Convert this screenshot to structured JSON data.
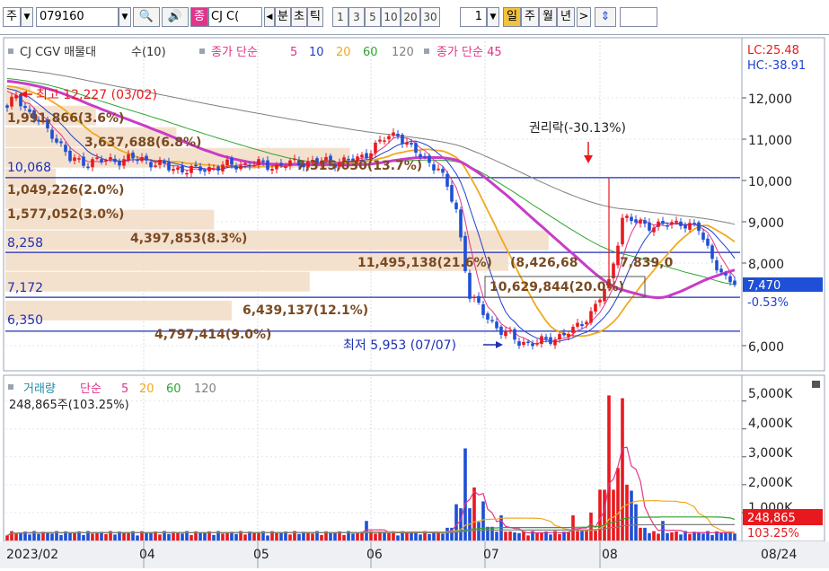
{
  "toolbar": {
    "market": "주",
    "code": "079160",
    "name_badge": "종",
    "name_short": "CJ  C(",
    "unit_label": "분",
    "unit_label2": "초",
    "unit_label3": "틱",
    "intervals": [
      "1",
      "3",
      "5",
      "10",
      "20",
      "30"
    ],
    "interval_count": "1",
    "periods": [
      "일",
      "주",
      "월",
      "년"
    ],
    "active_period": "일"
  },
  "colors": {
    "candle_up": "#e8191e",
    "candle_down": "#1f4fd6",
    "ma5": "#e0358a",
    "ma10": "#1f3fd0",
    "ma20": "#f0a920",
    "ma60": "#2ea52e",
    "ma120": "#808080",
    "ma45": "#c83cc8",
    "lc_hc": "#e8191e",
    "price_box": "#1f4fd6",
    "volume_box": "#e8191e",
    "hline": "#1e2fb5",
    "volume_profile": "#f2dcc4"
  },
  "price_panel": {
    "legend": {
      "name": "CJ CGV 매물대",
      "name_suffix": "수(10)",
      "ma_prefix": "종가 단순",
      "ma_periods": [
        "5",
        "10",
        "20",
        "60",
        "120"
      ],
      "ma45_label": "종가 단순 45"
    },
    "lc": "LC:25.48",
    "hc": "HC:-38.91",
    "axis_ticks": [
      "12,000",
      "11,000",
      "10,000",
      "9,000",
      "8,000",
      "6,000"
    ],
    "current_price": "7,470",
    "current_change": "-0.53%",
    "high_label": "최고 12,227 (03/02)",
    "low_label": "최저 5,953 (07/07)",
    "rights_label": "권리락(-30.13%)",
    "hlines": [
      {
        "label": "10,068"
      },
      {
        "label": "8,258"
      },
      {
        "label": "7,172"
      },
      {
        "label": "6,350"
      }
    ],
    "profile_labels": [
      "1,991,866(3.6%)",
      "3,637,688(6.8%)",
      "7,315,030(13.7%)",
      "1,049,226(2.0%)",
      "1,577,052(3.0%)",
      "4,397,853(8.3%)",
      "11,495,138(21.6%)",
      "(8,426,68",
      "7,839,0",
      "10,629,844(20.0%)",
      "6,439,137(12.1%)",
      "4,797,414(9.0%)"
    ]
  },
  "volume_panel": {
    "legend": {
      "title": "거래량",
      "ma_prefix": "단순",
      "ma_periods": [
        "5",
        "20",
        "60",
        "120"
      ]
    },
    "current_volume_text": "248,865주(103.25%)",
    "axis_ticks": [
      "5,000K",
      "4,000K",
      "3,000K",
      "2,000K",
      "1,000K"
    ],
    "current_volume": "248,865",
    "current_volume_pct": "103.25%"
  },
  "x_axis": {
    "labels": [
      "2023/02",
      "04",
      "05",
      "06",
      "07",
      "08"
    ],
    "last_date": "08/24"
  },
  "chart_data": {
    "type": "candlestick",
    "title": "CJ CGV",
    "y_range": [
      5700,
      12800
    ],
    "volume_range_k": [
      0,
      5600
    ],
    "price_axis_ticks": [
      12000,
      11000,
      10000,
      9000,
      8000,
      6000
    ],
    "volume_axis_ticks_k": [
      5000,
      4000,
      3000,
      2000,
      1000
    ],
    "high": {
      "value": 12227,
      "date": "03/02"
    },
    "low": {
      "value": 5953,
      "date": "07/07"
    },
    "rights_adjustment": {
      "pct": -30.13,
      "month": "08"
    },
    "horizontal_levels": [
      10068,
      8258,
      7172,
      6350
    ],
    "current": {
      "price": 7470,
      "change_pct": -0.53,
      "volume": 248865,
      "volume_pct": 103.25
    },
    "months": [
      "2023/02",
      "04",
      "05",
      "06",
      "07",
      "08"
    ],
    "price_path": [
      [
        0,
        11700
      ],
      [
        2,
        12100
      ],
      [
        5,
        11600
      ],
      [
        10,
        11150
      ],
      [
        14,
        10500
      ],
      [
        18,
        10450
      ],
      [
        24,
        10500
      ],
      [
        30,
        10520
      ],
      [
        36,
        10300
      ],
      [
        42,
        10250
      ],
      [
        48,
        10350
      ],
      [
        54,
        10400
      ],
      [
        60,
        10350
      ],
      [
        66,
        10450
      ],
      [
        72,
        10450
      ],
      [
        78,
        10500
      ],
      [
        84,
        11000
      ],
      [
        87,
        11150
      ],
      [
        90,
        10750
      ],
      [
        96,
        10300
      ],
      [
        100,
        9300
      ],
      [
        103,
        7200
      ],
      [
        106,
        6800
      ],
      [
        110,
        6350
      ],
      [
        114,
        6100
      ],
      [
        118,
        6050
      ],
      [
        122,
        6200
      ],
      [
        126,
        6350
      ],
      [
        130,
        6800
      ],
      [
        134,
        7500
      ],
      [
        137,
        9100
      ],
      [
        141,
        8950
      ],
      [
        146,
        8900
      ],
      [
        150,
        9000
      ],
      [
        154,
        8800
      ],
      [
        157,
        8150
      ],
      [
        160,
        7560
      ],
      [
        162,
        7470
      ]
    ],
    "volume_spikes_k": [
      {
        "i": 80,
        "v": 700
      },
      {
        "i": 100,
        "v": 1300
      },
      {
        "i": 102,
        "v": 3300
      },
      {
        "i": 104,
        "v": 1900
      },
      {
        "i": 106,
        "v": 1400
      },
      {
        "i": 110,
        "v": 900
      },
      {
        "i": 126,
        "v": 900
      },
      {
        "i": 130,
        "v": 1000
      },
      {
        "i": 134,
        "v": 5200
      },
      {
        "i": 136,
        "v": 2600
      },
      {
        "i": 137,
        "v": 5100
      },
      {
        "i": 138,
        "v": 2000
      },
      {
        "i": 140,
        "v": 1300
      },
      {
        "i": 146,
        "v": 700
      }
    ],
    "volume_profile_pct": [
      {
        "price": 12050,
        "pct": 1.0
      },
      {
        "price": 11570,
        "pct": 3.6
      },
      {
        "price": 11050,
        "pct": 6.8
      },
      {
        "price": 10550,
        "pct": 13.7
      },
      {
        "price": 10050,
        "pct": 2.0
      },
      {
        "price": 9550,
        "pct": 3.0
      },
      {
        "price": 9050,
        "pct": 8.3
      },
      {
        "price": 8550,
        "pct": 21.6
      },
      {
        "price": 8050,
        "pct": 20.0
      },
      {
        "price": 7550,
        "pct": 12.1
      },
      {
        "price": 6850,
        "pct": 9.0
      }
    ]
  }
}
